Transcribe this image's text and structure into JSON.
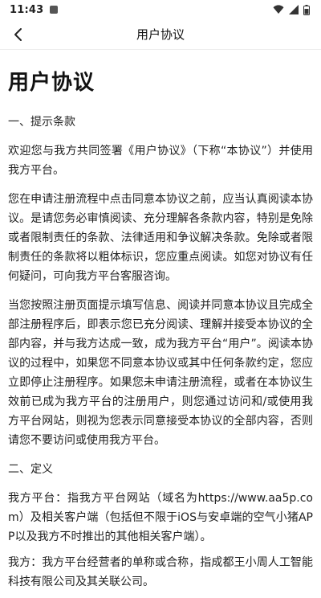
{
  "status_bar": {
    "time": "11:43"
  },
  "app_bar": {
    "title": "用户协议"
  },
  "document": {
    "title": "用户协议",
    "section1": {
      "heading": "一、提示条款",
      "paragraphs": [
        "欢迎您与我方共同签署《用户协议》（下称“本协议”）并使用我方平台。",
        "您在申请注册流程中点击同意本协议之前，应当认真阅读本协议。是请您务必审慎阅读、充分理解各条款内容，特别是免除或者限制责任的条款、法律适用和争议解决条款。免除或者限制责任的条款将以粗体标识，您应重点阅读。如您对协议有任何疑问，可向我方平台客服咨询。",
        "当您按照注册页面提示填写信息、阅读并同意本协议且完成全部注册程序后，即表示您已充分阅读、理解并接受本协议的全部内容，并与我方达成一致，成为我方平台“用户”。阅读本协议的过程中，如果您不同意本协议或其中任何条款约定，您应立即停止注册程序。如果您未申请注册流程，或者在本协议生效前已成为我方平台的注册用户，则您通过访问和/或使用我方平台网站，则视为您表示同意接受本协议的全部内容，否则请您不要访问或使用我方平台。"
      ]
    },
    "section2": {
      "heading": "二、定义",
      "paragraphs": [
        "我方平台：指我方平台网站（域名为https://www.aa5p.com）及相关客户端（包括但不限于iOS与安卓端的空气小猪APP以及我方不时推出的其他相关客户端）。",
        "我方：我方平台经营者的单称或合称，指成都王小周人工智能科技有限公司及其关联公司。"
      ]
    }
  }
}
